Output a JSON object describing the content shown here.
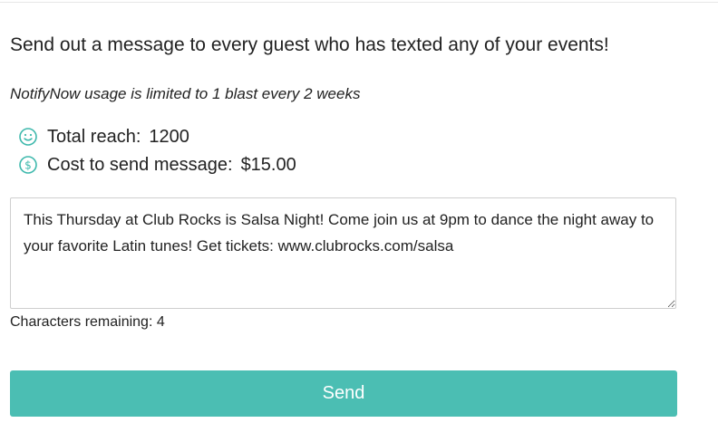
{
  "header": {
    "headline": "Send out a message to every guest who has texted any of your events!",
    "usage_note": "NotifyNow usage is limited to 1 blast every 2 weeks"
  },
  "stats": {
    "reach_label": "Total reach:",
    "reach_value": "1200",
    "cost_label": "Cost to send message:",
    "cost_value": "$15.00"
  },
  "icons": {
    "reach_icon": "smiley-face-icon",
    "cost_icon": "dollar-circle-icon"
  },
  "message": {
    "value": "This Thursday at Club Rocks is Salsa Night! Come join us at 9pm to dance the night away to your favorite Latin tunes! Get tickets: www.clubrocks.com/salsa"
  },
  "counter": {
    "text": "Characters remaining: 4"
  },
  "actions": {
    "send_label": "Send"
  },
  "colors": {
    "accent": "#4bbeb3",
    "icon": "#3fb9ad"
  }
}
